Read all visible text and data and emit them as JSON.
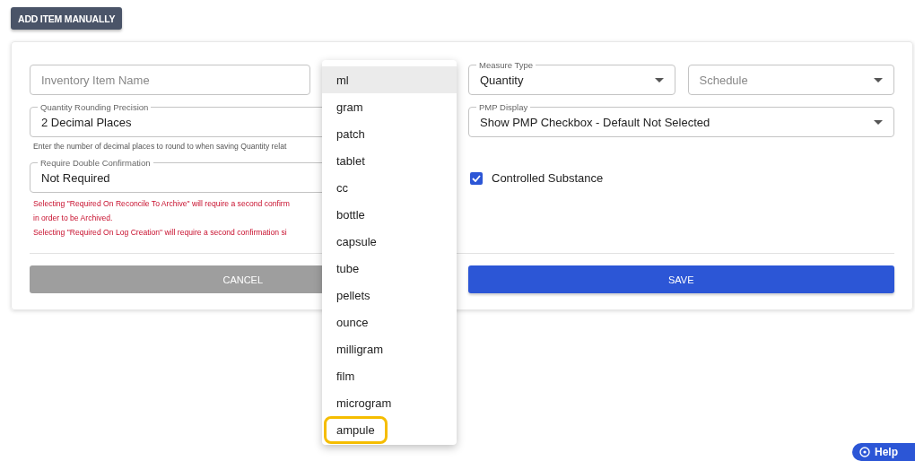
{
  "add_button": "ADD ITEM MANUALLY",
  "form": {
    "item_name": {
      "placeholder": "Inventory Item Name"
    },
    "rounding": {
      "label": "Quantity Rounding Precision",
      "value": "2 Decimal Places",
      "helper": "Enter the number of decimal places to round to when saving Quantity relat"
    },
    "double_confirmation": {
      "label": "Require Double Confirmation",
      "value": "Not Required",
      "errors": [
        "Selecting \"Required On Reconcile To Archive\" will require a second confirm",
        "in order to be Archived.",
        "Selecting \"Required On Log Creation\" will require a second confirmation si"
      ]
    },
    "measure_type": {
      "label": "Measure Type",
      "value": "Quantity"
    },
    "schedule": {
      "placeholder": "Schedule"
    },
    "pmp_display": {
      "label": "PMP Display",
      "value": "Show PMP Checkbox - Default Not Selected"
    },
    "controlled_substance": {
      "label": "Controlled Substance",
      "checked": true
    },
    "buttons": [
      {
        "label": "CANCEL",
        "kind": "cancel"
      },
      {
        "label": "SAVE",
        "kind": "save"
      }
    ]
  },
  "unit_menu": [
    {
      "label": "ml",
      "highlighted": true,
      "outlined": false
    },
    {
      "label": "gram",
      "highlighted": false,
      "outlined": false
    },
    {
      "label": "patch",
      "highlighted": false,
      "outlined": false
    },
    {
      "label": "tablet",
      "highlighted": false,
      "outlined": false
    },
    {
      "label": "cc",
      "highlighted": false,
      "outlined": false
    },
    {
      "label": "bottle",
      "highlighted": false,
      "outlined": false
    },
    {
      "label": "capsule",
      "highlighted": false,
      "outlined": false
    },
    {
      "label": "tube",
      "highlighted": false,
      "outlined": false
    },
    {
      "label": "pellets",
      "highlighted": false,
      "outlined": false
    },
    {
      "label": "ounce",
      "highlighted": false,
      "outlined": false
    },
    {
      "label": "milligram",
      "highlighted": false,
      "outlined": false
    },
    {
      "label": "film",
      "highlighted": false,
      "outlined": false
    },
    {
      "label": "microgram",
      "highlighted": false,
      "outlined": false
    },
    {
      "label": "ampule",
      "highlighted": false,
      "outlined": true
    }
  ],
  "help_button": "Help"
}
